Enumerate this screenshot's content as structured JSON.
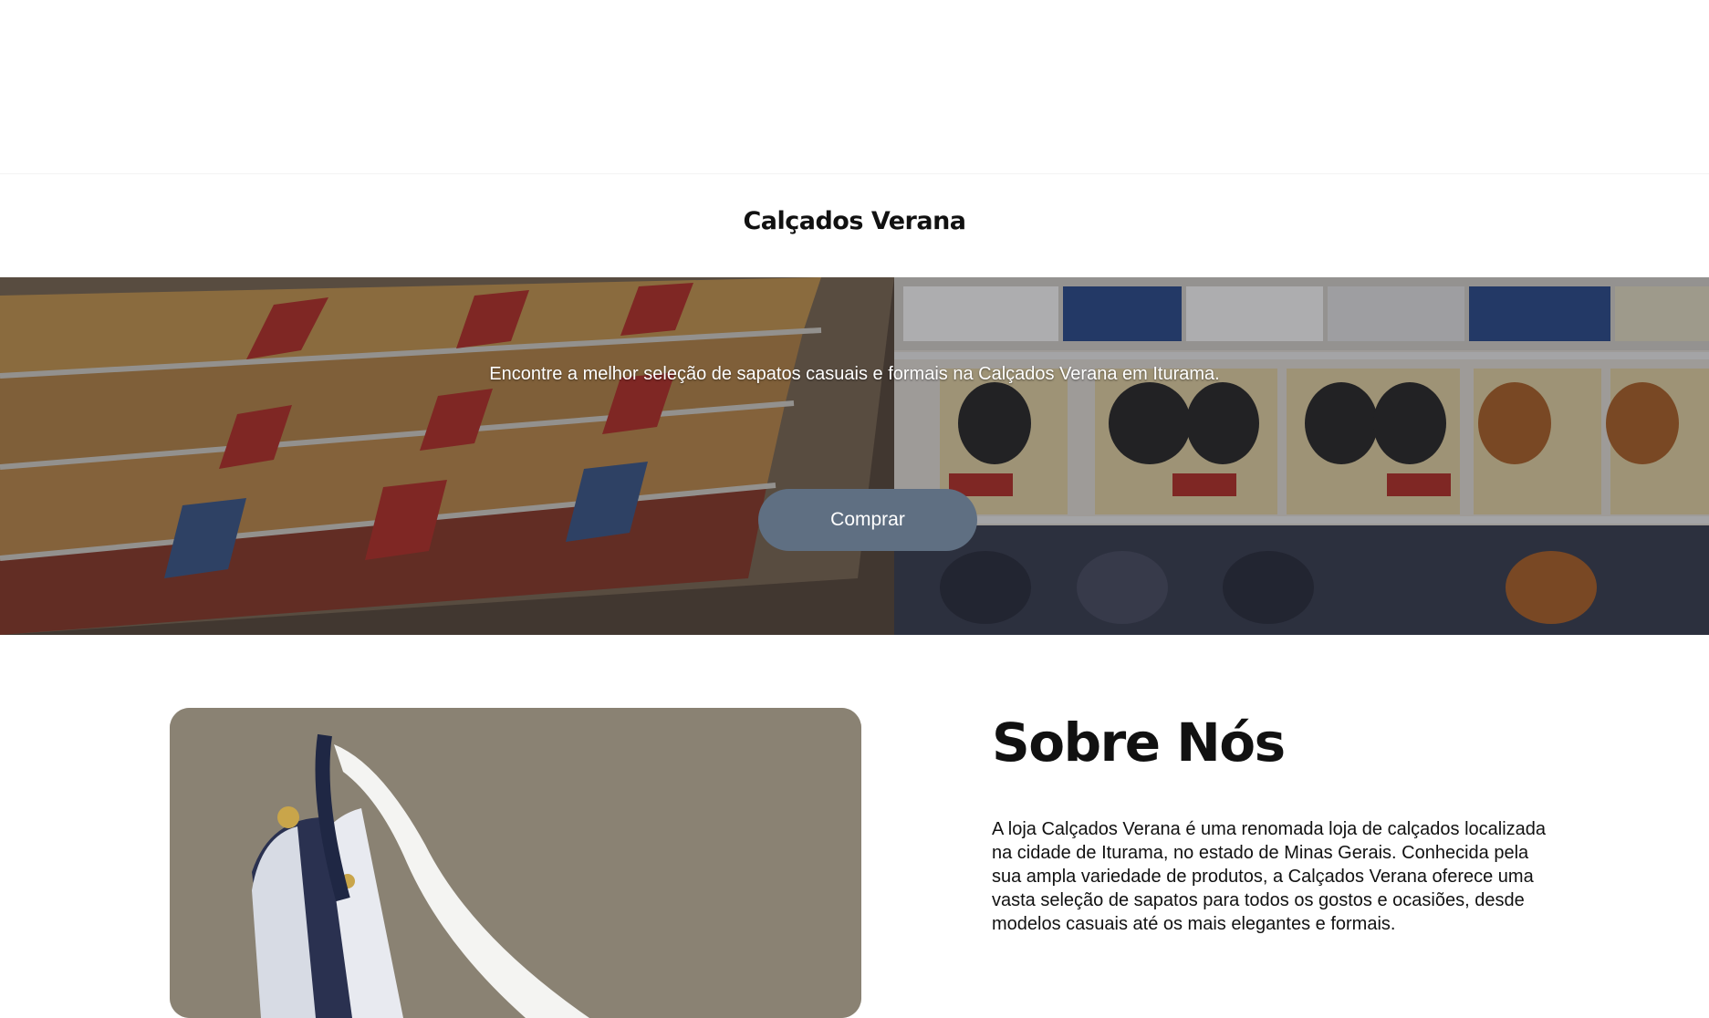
{
  "header": {
    "brand": "Calçados Verana"
  },
  "hero": {
    "subtitle": "Encontre a melhor seleção de sapatos casuais e formais na Calçados Verana em Iturama.",
    "cta_label": "Comprar",
    "cta_color": "#5f6f82",
    "image_icon": "shoe-store-shelves-image"
  },
  "about": {
    "title": "Sobre Nós",
    "paragraph1": "A loja Calçados Verana é uma renomada loja de calçados localizada na cidade de Iturama, no estado de Minas Gerais. Conhecida pela sua ampla variedade de produtos, a Calçados Verana oferece uma vasta seleção de sapatos para todos os gostos e ocasiões, desde modelos casuais até os mais elegantes e formais.",
    "paragraph2": "",
    "image_icon": "slingback-shoe-image"
  }
}
